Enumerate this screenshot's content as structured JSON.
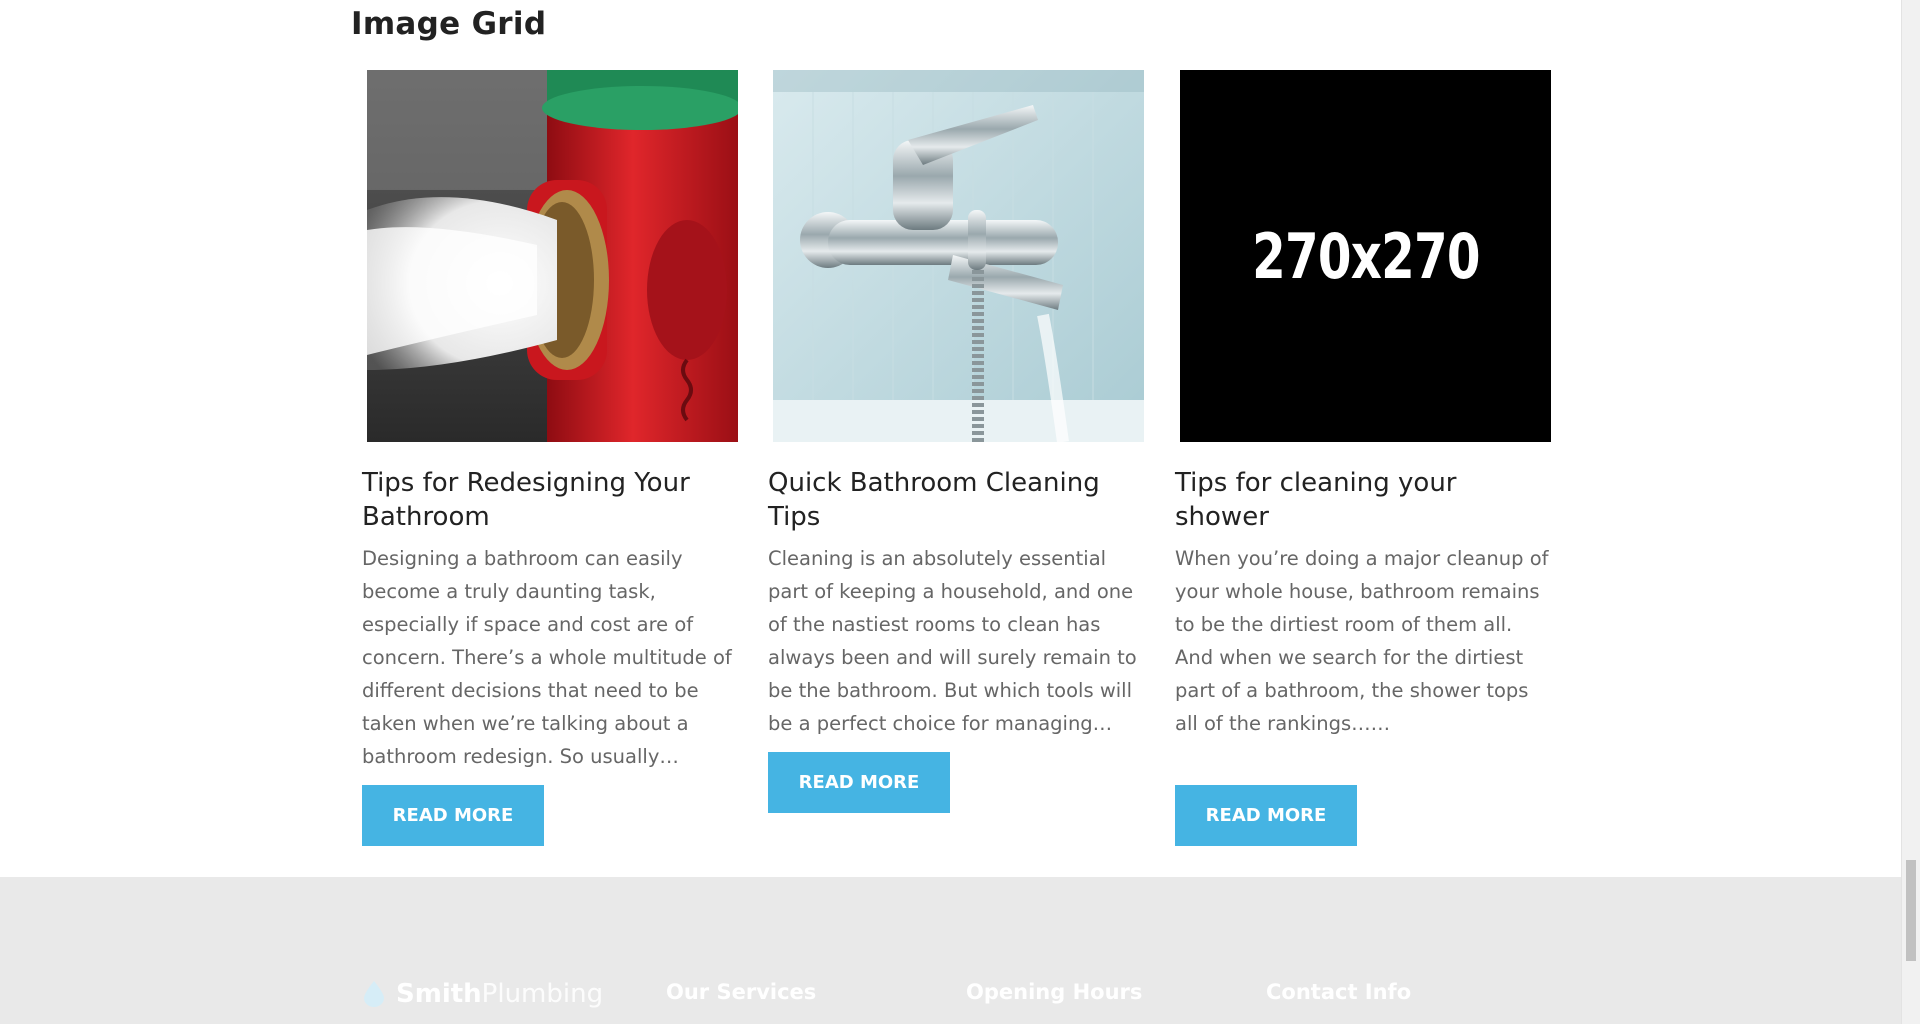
{
  "section": {
    "title": "Image Grid"
  },
  "cards": [
    {
      "image": "fire hydrant spraying water",
      "title": "Tips for Redesigning Your Bathroom",
      "excerpt": "  Designing a bathroom can easily become a truly daunting task, especially if space and cost are of concern. There’s a whole multitude of different decisions that need to be taken when we’re talking about a bathroom redesign. So usually…",
      "button": "READ MORE"
    },
    {
      "image": "chrome bath faucet with shower hose",
      "title": "Quick Bathroom Cleaning Tips",
      "excerpt": "  Cleaning is an absolutely essential part of keeping a household, and one of the nastiest rooms to clean has always been and will surely remain to be the bathroom. But which tools will be a perfect choice for managing…",
      "button": "READ MORE"
    },
    {
      "image_text": "270x270",
      "title": "Tips for cleaning your shower",
      "excerpt": "    When you’re doing a major cleanup of your whole house, bathroom remains to be the dirtiest room of them all. And when we search for the dirtiest part of a bathroom, the shower tops all of the rankings……",
      "button": "READ MORE"
    }
  ],
  "footer": {
    "brand_bold": "Smith",
    "brand_light": "Plumbing",
    "columns": [
      "Our Services",
      "Opening Hours",
      "Contact Info"
    ]
  },
  "colors": {
    "accent": "#45b4e3",
    "footer_bg": "#e9e9e9"
  }
}
